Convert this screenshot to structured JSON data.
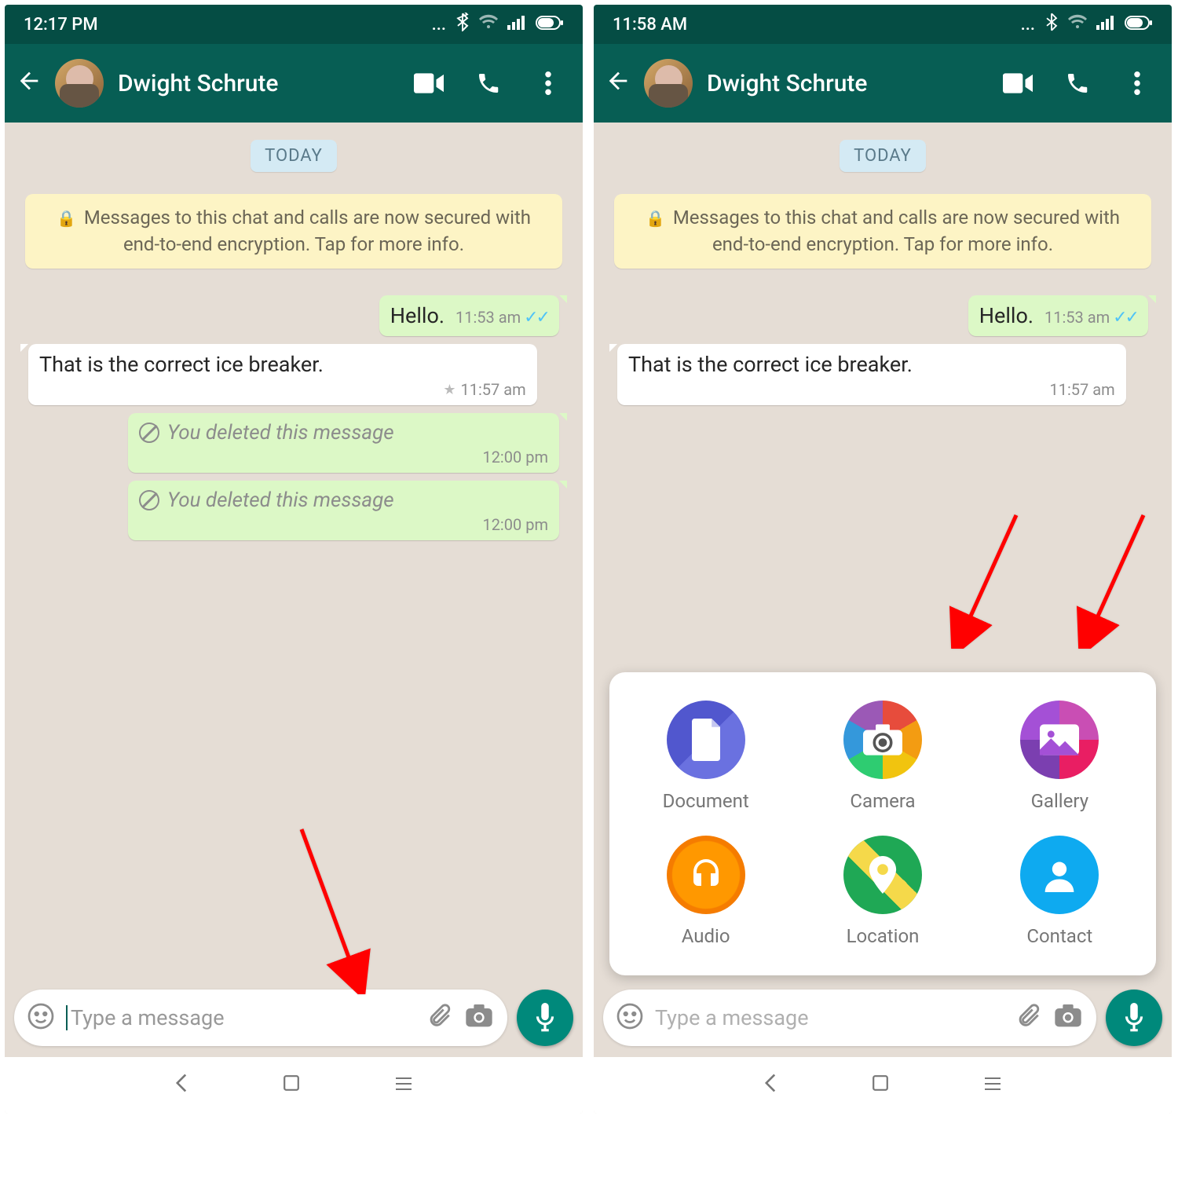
{
  "left": {
    "status_time": "12:17 PM",
    "contact": "Dwight Schrute",
    "date_label": "TODAY",
    "enc_text": "Messages to this chat and calls are now secured with end-to-end encryption. Tap for more info.",
    "msg_hello": "Hello.",
    "msg_hello_time": "11:53 am",
    "msg_in1": "That is the correct ice breaker.",
    "msg_in1_time": "11:57 am",
    "deleted_text": "You deleted this message",
    "deleted_time1": "12:00 pm",
    "deleted_time2": "12:00 pm",
    "input_placeholder": "Type a message"
  },
  "right": {
    "status_time": "11:58 AM",
    "contact": "Dwight Schrute",
    "date_label": "TODAY",
    "enc_text": "Messages to this chat and calls are now secured with end-to-end encryption. Tap for more info.",
    "msg_hello": "Hello.",
    "msg_hello_time": "11:53 am",
    "msg_in1": "That is the correct ice breaker.",
    "msg_in1_time": "11:57 am",
    "input_placeholder": "Type a message",
    "attach": {
      "doc": "Document",
      "cam": "Camera",
      "gal": "Gallery",
      "aud": "Audio",
      "loc": "Location",
      "con": "Contact"
    }
  }
}
